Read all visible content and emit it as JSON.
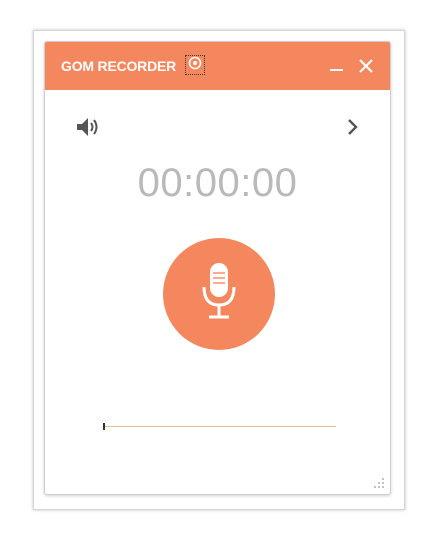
{
  "app": {
    "title": "GOM RECORDER"
  },
  "timer": {
    "elapsed": "00:00:00"
  },
  "icons": {
    "settings": "gear-icon",
    "minimize": "minimize-icon",
    "close": "close-icon",
    "speaker": "speaker-icon",
    "expand": "chevron-right-icon",
    "record": "microphone-icon",
    "resize": "resize-grip-icon"
  },
  "playback": {
    "progress": 0
  },
  "colors": {
    "accent": "#f5875e",
    "timer_text": "#b9b9b9",
    "icon_dark": "#555555",
    "track": "#f0b88f"
  }
}
